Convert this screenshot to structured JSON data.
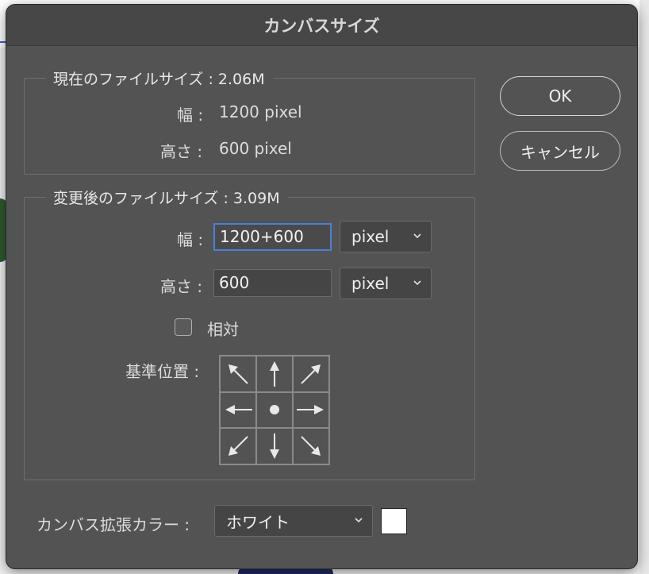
{
  "dialog": {
    "title": "カンバスサイズ",
    "ok_label": "OK",
    "cancel_label": "キャンセル"
  },
  "current_size": {
    "legend": "現在のファイルサイズ : 2.06M",
    "width_label": "幅 :",
    "width_value": "1200 pixel",
    "height_label": "高さ :",
    "height_value": "600 pixel"
  },
  "new_size": {
    "legend": "変更後のファイルサイズ : 3.09M",
    "width_label": "幅 :",
    "width_value": "1200+600",
    "width_unit": "pixel",
    "height_label": "高さ :",
    "height_value": "600",
    "height_unit": "pixel",
    "relative_label": "相対",
    "relative_checked": false,
    "anchor_label": "基準位置 :",
    "anchor_selected": "center"
  },
  "extension": {
    "label": "カンバス拡張カラー :",
    "value": "ホワイト",
    "swatch_color": "#ffffff"
  },
  "icons": [
    "chevron-down-icon",
    "arrow-up-left-icon",
    "arrow-up-icon",
    "arrow-up-right-icon",
    "arrow-left-icon",
    "center-dot-icon",
    "arrow-right-icon",
    "arrow-down-left-icon",
    "arrow-down-icon",
    "arrow-down-right-icon"
  ]
}
